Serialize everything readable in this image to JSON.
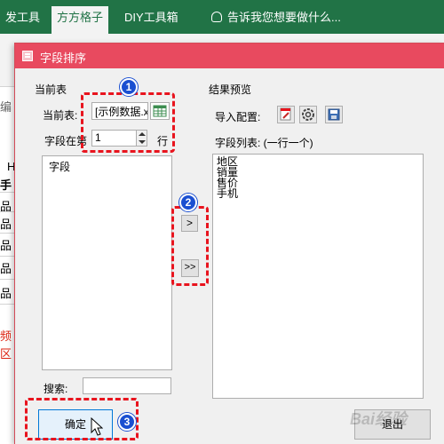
{
  "excel": {
    "tabs": [
      "发工具",
      "方方格子",
      "DIY工具箱"
    ],
    "tell_me": "告诉我您想要做什么...",
    "sheet_fragments": [
      "编",
      "H",
      "手",
      "品",
      "品",
      "品",
      "品",
      "品",
      "频",
      "区"
    ]
  },
  "dialog": {
    "title": "字段排序",
    "left_section_label": "当前表",
    "current_table_label": "当前表:",
    "current_table_value": "[示例数据.xl",
    "field_row_label": "字段在第",
    "field_row_value": "1",
    "field_row_suffix": "行",
    "left_list": [
      "字段"
    ],
    "search_label": "搜索:",
    "search_value": "",
    "move_one_label": ">",
    "move_all_label": ">>",
    "right_section_label": "结果预览",
    "import_config_label": "导入配置:",
    "field_list_label": "字段列表: (一行一个)",
    "right_list": [
      "地区",
      "销量",
      "售价",
      "手机"
    ],
    "ok_label": "确定",
    "exit_label": "退出"
  },
  "annotations": {
    "badge1": "1",
    "badge2": "2",
    "badge3": "3"
  },
  "watermark": "Bai经验",
  "colors": {
    "excel_green": "#217346",
    "dialog_title": "#e84a5f",
    "annotation_red": "#e8141e",
    "badge_blue": "#1a4fd1"
  }
}
